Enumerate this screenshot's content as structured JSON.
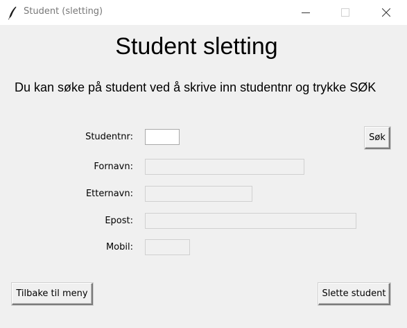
{
  "window": {
    "title": "Student (sletting)",
    "icon": "feather-icon"
  },
  "header": {
    "title": "Student sletting",
    "instruction": "Du kan søke på student ved å skrive inn studentnr og trykke SØK"
  },
  "form": {
    "studentnr": {
      "label": "Studentnr:",
      "value": ""
    },
    "fornavn": {
      "label": "Fornavn:",
      "value": ""
    },
    "etternavn": {
      "label": "Etternavn:",
      "value": ""
    },
    "epost": {
      "label": "Epost:",
      "value": ""
    },
    "mobil": {
      "label": "Mobil:",
      "value": ""
    }
  },
  "buttons": {
    "search": "Søk",
    "back": "Tilbake til meny",
    "delete": "Slette student"
  }
}
